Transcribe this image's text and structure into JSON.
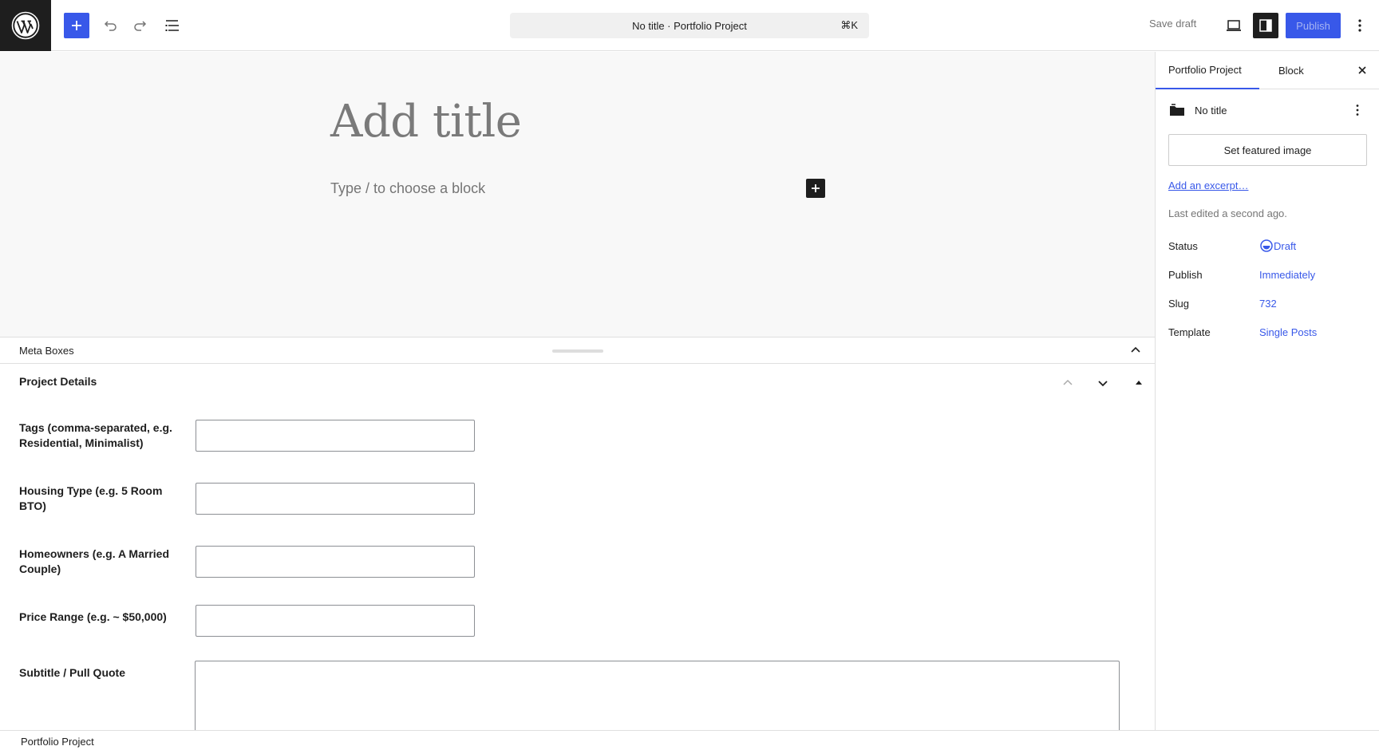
{
  "app": {
    "logo": "wordpress-logo"
  },
  "toolbar": {
    "command_title": "No title · Portfolio Project",
    "command_shortcut": "⌘K",
    "save_draft": "Save draft",
    "publish": "Publish",
    "icons": [
      "plus-icon",
      "undo-icon",
      "redo-icon",
      "document-overview-icon",
      "desktop-preview-icon",
      "settings-sidebar-icon",
      "more-vertical-icon"
    ]
  },
  "editor": {
    "title_placeholder": "Add title",
    "block_placeholder": "Type / to choose a block"
  },
  "meta": {
    "bar_label": "Meta Boxes",
    "panel_title": "Project Details",
    "fields": [
      {
        "label": "Tags (comma-separated, e.g. Residential, Minimalist)",
        "value": ""
      },
      {
        "label": "Housing Type (e.g. 5 Room BTO)",
        "value": ""
      },
      {
        "label": "Homeowners (e.g. A Married Couple)",
        "value": ""
      },
      {
        "label": "Price Range (e.g. ~ $50,000)",
        "value": ""
      },
      {
        "label": "Subtitle / Pull Quote",
        "value": ""
      }
    ]
  },
  "footer": {
    "breadcrumb": "Portfolio Project"
  },
  "sidebar": {
    "tabs": [
      "Portfolio Project",
      "Block"
    ],
    "post_title": "No title",
    "featured_image_button": "Set featured image",
    "excerpt_link": "Add an excerpt…",
    "last_edited": "Last edited a second ago.",
    "props": [
      {
        "key": "Status",
        "value": "Draft"
      },
      {
        "key": "Publish",
        "value": "Immediately"
      },
      {
        "key": "Slug",
        "value": "732"
      },
      {
        "key": "Template",
        "value": "Single Posts"
      }
    ]
  },
  "colors": {
    "accent": "#3858e9",
    "dark": "#1e1e1e"
  }
}
